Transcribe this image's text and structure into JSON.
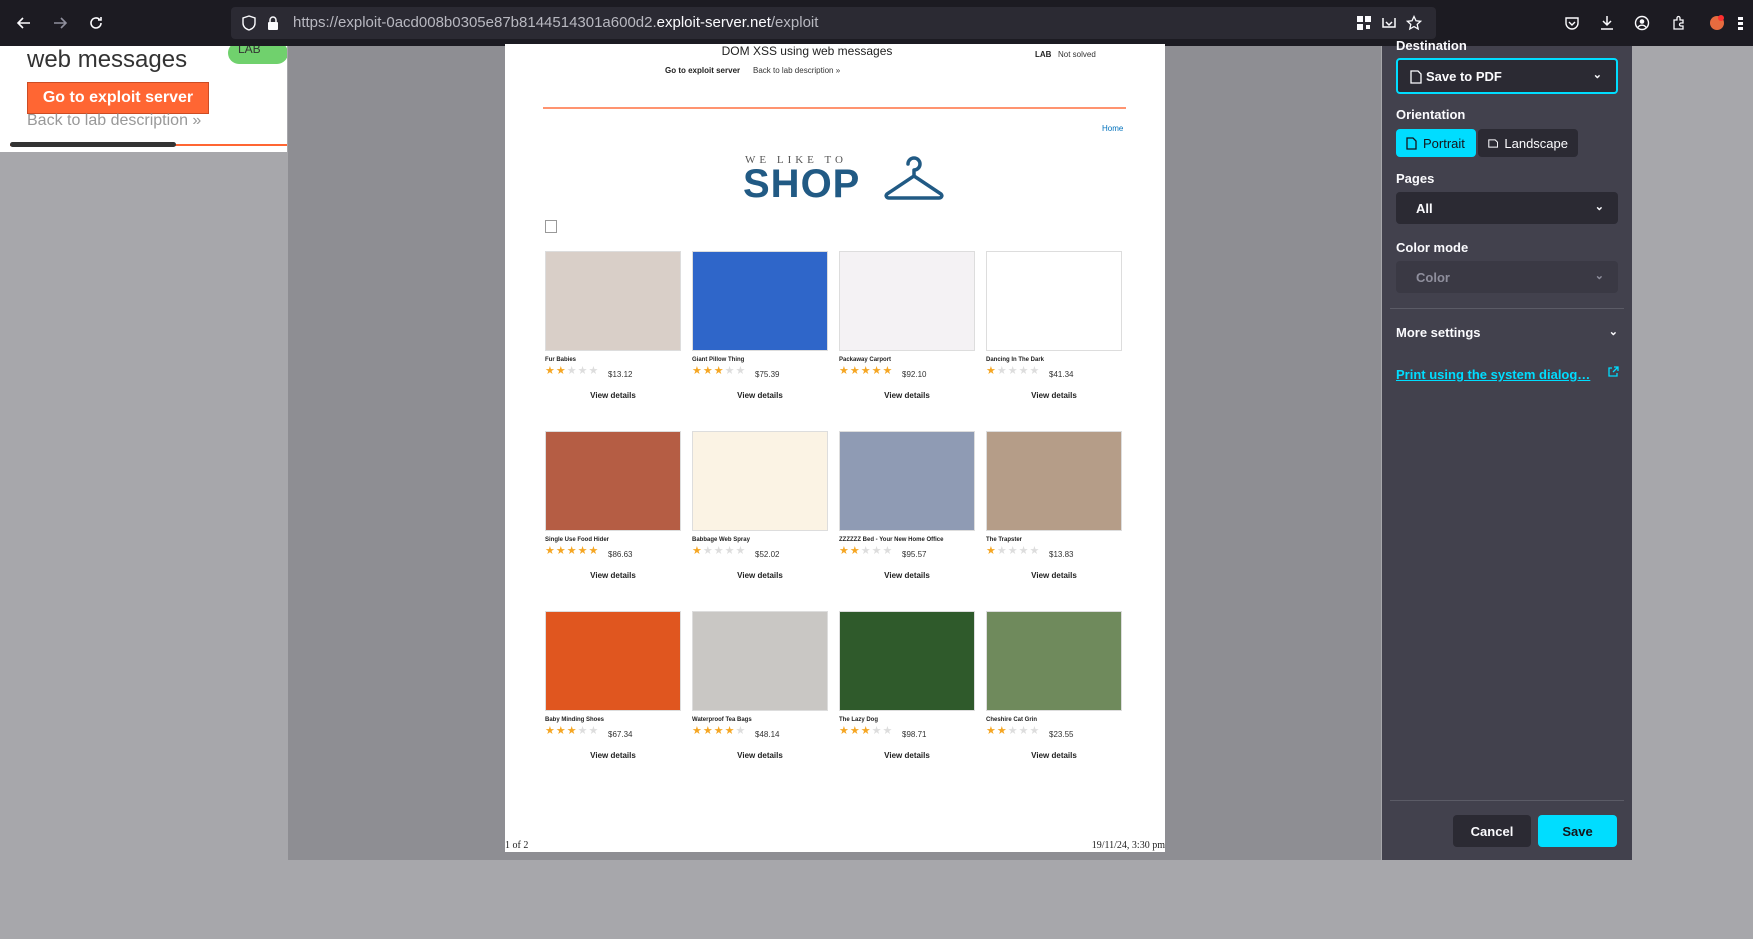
{
  "browser": {
    "url_prefix": "https://exploit-0acd008b0305e87b8144514301a600d2.",
    "url_domain": "exploit-server.net",
    "url_path": "/exploit"
  },
  "bg_page": {
    "title": "web messages",
    "badge": "LAB",
    "button": "Go to exploit server",
    "back": "Back to lab description  »"
  },
  "preview": {
    "title": "DOM XSS using web messages",
    "goto": "Go to exploit server",
    "back": "Back to lab description  »",
    "lab": "LAB",
    "status": "Not solved",
    "home": "Home",
    "logo_top": "WE LIKE TO",
    "logo_shop": "SHOP",
    "view_label": "View details",
    "footer_left": "1 of 2",
    "footer_right": "19/11/24, 3:30 pm",
    "products": [
      {
        "name": "Fur Babies",
        "rating": 2,
        "price": "$13.12",
        "color": "#d9cfc8"
      },
      {
        "name": "Giant Pillow Thing",
        "rating": 3,
        "price": "$75.39",
        "color": "#2f66c9"
      },
      {
        "name": "Packaway Carport",
        "rating": 5,
        "price": "$92.10",
        "color": "#f4f2f4"
      },
      {
        "name": "Dancing In The Dark",
        "rating": 1,
        "price": "$41.34",
        "color": "#ffffff"
      },
      {
        "name": "Single Use Food Hider",
        "rating": 5,
        "price": "$86.63",
        "color": "#b55d44"
      },
      {
        "name": "Babbage Web Spray",
        "rating": 1,
        "price": "$52.02",
        "color": "#fbf3e4"
      },
      {
        "name": "ZZZZZZ Bed - Your New Home Office",
        "rating": 2,
        "price": "$95.57",
        "color": "#8f9bb4"
      },
      {
        "name": "The Trapster",
        "rating": 1,
        "price": "$13.83",
        "color": "#b59d88"
      },
      {
        "name": "Baby Minding Shoes",
        "rating": 3,
        "price": "$67.34",
        "color": "#e0561f"
      },
      {
        "name": "Waterproof Tea Bags",
        "rating": 4,
        "price": "$48.14",
        "color": "#c9c7c4"
      },
      {
        "name": "The Lazy Dog",
        "rating": 3,
        "price": "$98.71",
        "color": "#2f5a2b"
      },
      {
        "name": "Cheshire Cat Grin",
        "rating": 2,
        "price": "$23.55",
        "color": "#6f8a5c"
      }
    ]
  },
  "print_panel": {
    "destination_label": "Destination",
    "destination_value": "Save to PDF",
    "orientation_label": "Orientation",
    "portrait": "Portrait",
    "landscape": "Landscape",
    "pages_label": "Pages",
    "pages_value": "All",
    "color_mode_label": "Color mode",
    "color_mode_value": "Color",
    "more_settings": "More settings",
    "system_dialog": "Print using the system dialog…",
    "cancel": "Cancel",
    "save": "Save"
  },
  "colors": {
    "accent": "#00ddff",
    "lab_orange": "#ff6633",
    "star": "#f5a623"
  }
}
